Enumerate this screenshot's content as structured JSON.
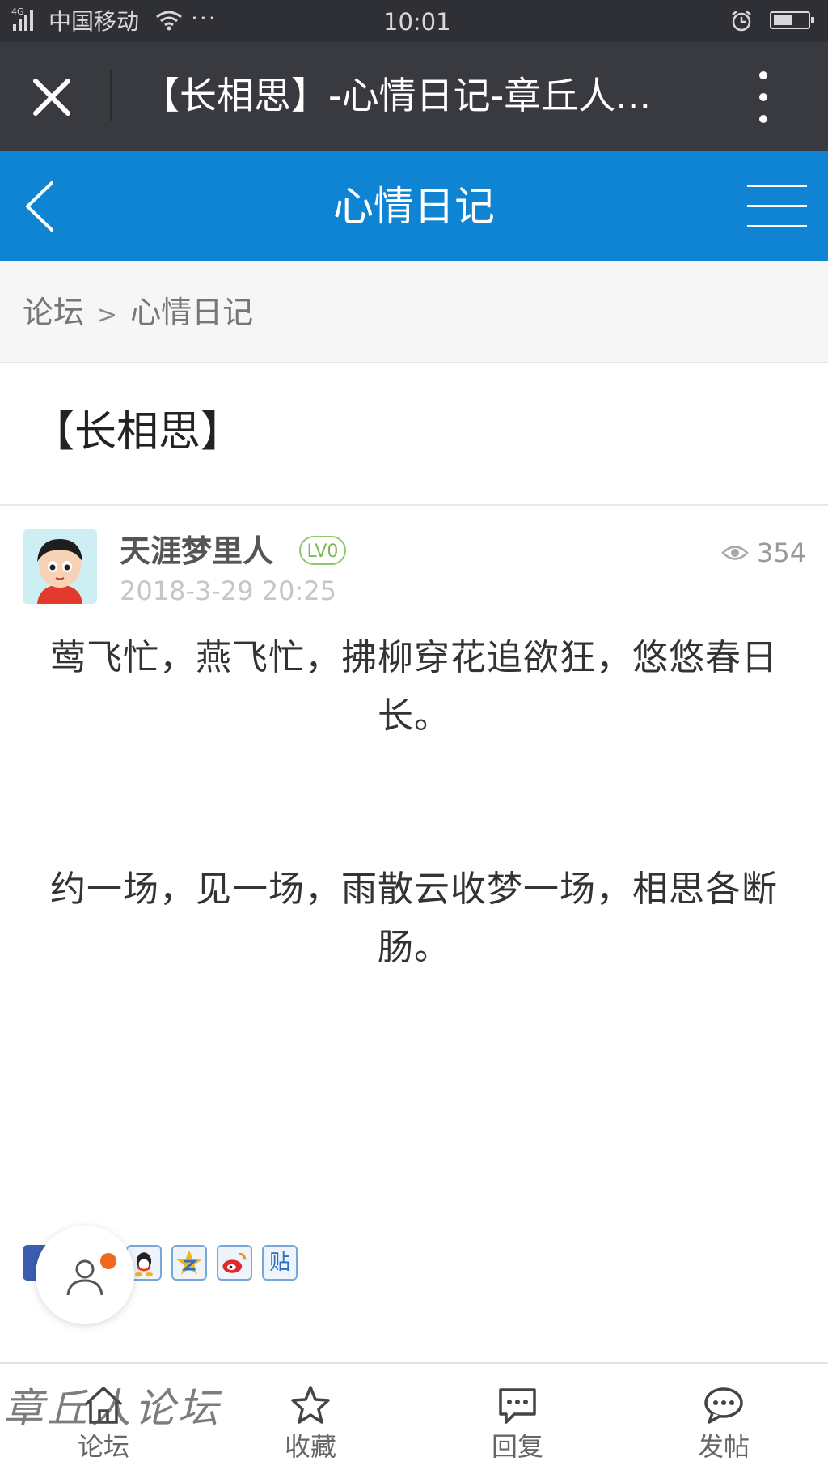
{
  "status_bar": {
    "network": "4G",
    "carrier": "中国移动",
    "dots": "···",
    "time": "10:01",
    "battery_level": 0.55
  },
  "wechat_bar": {
    "title": "【长相思】-心情日记-章丘人..."
  },
  "forum_header": {
    "title": "心情日记"
  },
  "breadcrumb": {
    "root": "论坛",
    "separator": ">",
    "current": "心情日记"
  },
  "post": {
    "title": "【长相思】",
    "author": "天涯梦里人",
    "level": "LV0",
    "time": "2018-3-29 20:25",
    "views": "354",
    "paragraphs": [
      "莺飞忙，燕飞忙，拂柳穿花追欲狂，悠悠春日长。",
      "约一场，见一场，雨散云收梦一场，相思各断肠。"
    ]
  },
  "share_icons": [
    "facebook-icon",
    "qzone-icon",
    "qq-icon",
    "qzone-star-icon",
    "weibo-icon",
    "tieba-icon"
  ],
  "share_tieba_text": "贴",
  "tabbar": {
    "forum": "论坛",
    "favorite": "收藏",
    "reply": "回复",
    "post": "发帖"
  },
  "watermark": "章丘人论坛",
  "colors": {
    "header_blue": "#0e84d3",
    "wechat_dark": "#393a3f",
    "level_green": "#7bb95a",
    "badge_orange": "#f06a1e"
  }
}
